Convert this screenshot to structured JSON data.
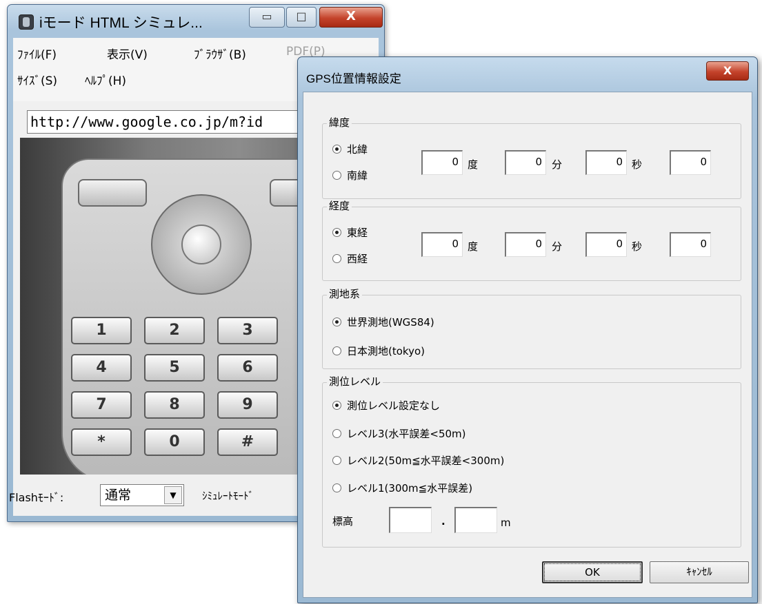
{
  "back_window": {
    "title": "iモード HTML シミュレ...",
    "caption_buttons": {
      "minimize": "▭",
      "maximize": "□",
      "close": "X"
    },
    "menu": [
      {
        "label": "ﾌｧｲﾙ(F)",
        "disabled": false
      },
      {
        "label": "表示(V)",
        "disabled": false
      },
      {
        "label": "ﾌﾞﾗｳｻﾞ(B)",
        "disabled": false
      },
      {
        "label": "PDF(P)",
        "disabled": true
      },
      {
        "label": "ｻｲｽﾞ(S)",
        "disabled": false
      },
      {
        "label": "ﾍﾙﾌﾟ(H)",
        "disabled": false
      }
    ],
    "url": "http://www.google.co.jp/m?id",
    "keypad": [
      "1",
      "2",
      "3",
      "4",
      "5",
      "6",
      "7",
      "8",
      "9",
      "*",
      "0",
      "#"
    ],
    "status": {
      "flash_label": "Flashﾓｰﾄﾞ:",
      "flash_value": "通常",
      "simulate_label": "ｼﾐｭﾚｰﾄﾓｰﾄﾞ"
    }
  },
  "dialog": {
    "title": "GPS位置情報設定",
    "close_label": "X",
    "latitude": {
      "label": "緯度",
      "options": [
        {
          "label": "北緯",
          "checked": true
        },
        {
          "label": "南緯",
          "checked": false
        }
      ],
      "degree": "0",
      "degree_unit": "度",
      "minute": "0",
      "minute_unit": "分",
      "second": "0",
      "second_unit": "秒",
      "fraction": "0"
    },
    "longitude": {
      "label": "経度",
      "options": [
        {
          "label": "東経",
          "checked": true
        },
        {
          "label": "西経",
          "checked": false
        }
      ],
      "degree": "0",
      "degree_unit": "度",
      "minute": "0",
      "minute_unit": "分",
      "second": "0",
      "second_unit": "秒",
      "fraction": "0"
    },
    "datum": {
      "label": "測地系",
      "options": [
        {
          "label": "世界測地(WGS84)",
          "checked": true
        },
        {
          "label": "日本測地(tokyo)",
          "checked": false
        }
      ]
    },
    "level": {
      "label": "測位レベル",
      "options": [
        {
          "label": "測位レベル設定なし",
          "checked": true
        },
        {
          "label": "レベル3(水平誤差<50m)",
          "checked": false
        },
        {
          "label": "レベル2(50m≦水平誤差<300m)",
          "checked": false
        },
        {
          "label": "レベル1(300m≦水平誤差)",
          "checked": false
        }
      ],
      "altitude_label": "標高",
      "altitude_int": "",
      "altitude_dot": ".",
      "altitude_frac": "",
      "altitude_unit": "m"
    },
    "buttons": {
      "ok": "OK",
      "cancel": "ｷｬﾝｾﾙ"
    }
  }
}
